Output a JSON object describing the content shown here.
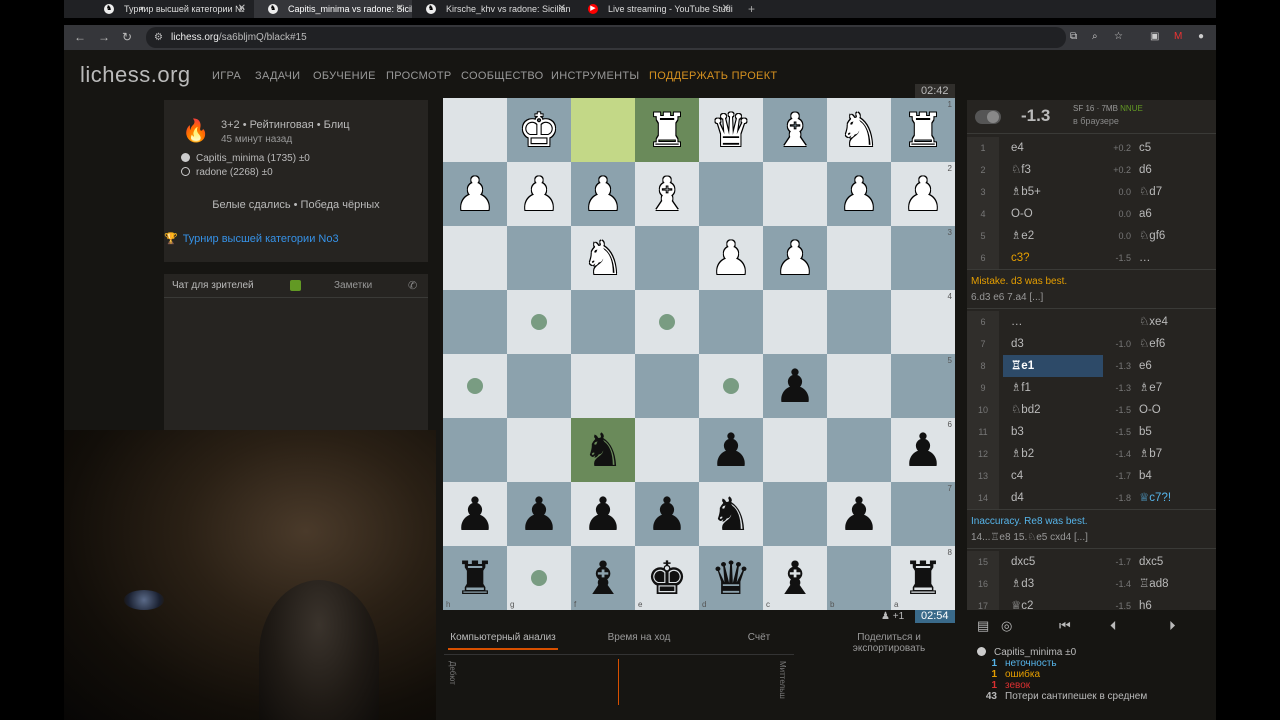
{
  "browser": {
    "tabs": [
      {
        "title": "Турнир высшей категории №",
        "icon": "lichess-icon"
      },
      {
        "title": "Capitis_minima vs radone: Sicili",
        "icon": "lichess-icon"
      },
      {
        "title": "Kirsche_khv vs radone: Sicilian ",
        "icon": "lichess-icon"
      },
      {
        "title": "Live streaming - YouTube Studi",
        "icon": "youtube-icon"
      }
    ],
    "active_tab_index": 1,
    "url_host": "lichess.org",
    "url_path": "/sa6bljmQ/black#15"
  },
  "site": {
    "logo": "lichess.org",
    "nav": [
      "ИГРА",
      "ЗАДАЧИ",
      "ОБУЧЕНИЕ",
      "ПРОСМОТР",
      "СООБЩЕСТВО",
      "ИНСТРУМЕНТЫ"
    ],
    "donate": "ПОДДЕРЖАТЬ ПРОЕКТ"
  },
  "game": {
    "title": "3+2 • Рейтинговая • Блиц",
    "time_ago": "45 минут назад",
    "white_player": "Capitis_minima (1735) ±0",
    "black_player": "radone (2268) ±0",
    "status": "Белые сдались • Победа чёрных",
    "tournament": "Турнир высшей категории No3"
  },
  "chat": {
    "spectator_tab": "Чат для зрителей",
    "notes_tab": "Заметки"
  },
  "clocks": {
    "top": "02:42",
    "bottom": "02:54",
    "bottom_extra": "+1"
  },
  "board": {
    "ranks_labels": [
      "1",
      "2",
      "3",
      "4",
      "5",
      "6",
      "7",
      "8"
    ],
    "files_labels": [
      "h",
      "g",
      "f",
      "e",
      "d",
      "c",
      "b",
      "a"
    ],
    "rows": [
      [
        "",
        "wK",
        "",
        "wR",
        "wQ",
        "wB",
        "wN",
        "wR"
      ],
      [
        "wP",
        "wP",
        "wP",
        "wB",
        "",
        "",
        "wP",
        "wP"
      ],
      [
        "",
        "",
        "wN",
        "",
        "wP",
        "wP",
        "",
        ""
      ],
      [
        "",
        "",
        "",
        "",
        "",
        "",
        "",
        ""
      ],
      [
        "",
        "",
        "",
        "",
        "",
        "bP",
        "",
        ""
      ],
      [
        "",
        "",
        "bN",
        "",
        "bP",
        "",
        "",
        "bP"
      ],
      [
        "bP",
        "bP",
        "bP",
        "bP",
        "bN",
        "",
        "bP",
        ""
      ],
      [
        "bR",
        "",
        "bB",
        "bK",
        "bQ",
        "bB",
        "",
        "bR"
      ]
    ],
    "highlight_squares": [
      [
        0,
        2
      ],
      [
        0,
        3
      ],
      [
        5,
        2
      ]
    ],
    "move_dots": [
      [
        3,
        1
      ],
      [
        3,
        3
      ],
      [
        4,
        0
      ],
      [
        4,
        4
      ],
      [
        7,
        1
      ]
    ]
  },
  "analysis_tabs": [
    "Компьютерный анализ",
    "Время на ход",
    "Счёт",
    "Поделиться и экспортировать"
  ],
  "graph": {
    "label_left": "Дебют",
    "label_right": "Миттельш"
  },
  "engine": {
    "eval": "-1.3",
    "name": "SF 16 · 7MB",
    "nnue": "NNUE",
    "sub": "в браузере"
  },
  "moves_a": [
    {
      "n": "1",
      "w": "e4",
      "we": "+0.2",
      "b": "c5"
    },
    {
      "n": "2",
      "w": "♘f3",
      "we": "+0.2",
      "b": "d6"
    },
    {
      "n": "3",
      "w": "♗b5+",
      "we": "0.0",
      "b": "♘d7"
    },
    {
      "n": "4",
      "w": "O-O",
      "we": "0.0",
      "b": "a6"
    },
    {
      "n": "5",
      "w": "♗e2",
      "we": "0.0",
      "b": "♘gf6"
    },
    {
      "n": "6",
      "w": "c3?",
      "we": "-1.5",
      "b": "…"
    }
  ],
  "comment_a": {
    "text": "Mistake. d3 was best.",
    "line": "6.d3 e6 7.a4 [...]"
  },
  "moves_b": [
    {
      "n": "6",
      "w": "…",
      "we": "",
      "b": "♘xe4"
    },
    {
      "n": "7",
      "w": "d3",
      "we": "-1.0",
      "b": "♘ef6"
    },
    {
      "n": "8",
      "w": "♖e1",
      "we": "-1.3",
      "b": "e6"
    },
    {
      "n": "9",
      "w": "♗f1",
      "we": "-1.3",
      "b": "♗e7"
    },
    {
      "n": "10",
      "w": "♘bd2",
      "we": "-1.5",
      "b": "O-O"
    },
    {
      "n": "11",
      "w": "b3",
      "we": "-1.5",
      "b": "b5"
    },
    {
      "n": "12",
      "w": "♗b2",
      "we": "-1.4",
      "b": "♗b7"
    },
    {
      "n": "13",
      "w": "c4",
      "we": "-1.7",
      "b": "b4"
    },
    {
      "n": "14",
      "w": "d4",
      "we": "-1.8",
      "b": "♕c7?!"
    }
  ],
  "comment_b": {
    "text": "Inaccuracy. Re8 was best.",
    "line": "14...♖e8 15.♘e5 cxd4 [...]"
  },
  "moves_c": [
    {
      "n": "15",
      "w": "dxc5",
      "we": "-1.7",
      "b": "dxc5"
    },
    {
      "n": "16",
      "w": "♗d3",
      "we": "-1.4",
      "b": "♖ad8"
    },
    {
      "n": "17",
      "w": "♕c2",
      "we": "-1.5",
      "b": "h6"
    }
  ],
  "acpl": {
    "player": "Capitis_minima ±0",
    "inacc_count": "1",
    "inacc_label": "неточность",
    "mistake_count": "1",
    "mistake_label": "ошибка",
    "blunder_count": "1",
    "blunder_label": "зевок",
    "avg_count": "43",
    "avg_label": "Потери сантипешек в среднем"
  },
  "colors": {
    "donate": "#d59120",
    "link": "#3692e7",
    "mistake": "#e69f00",
    "inaccuracy": "#56b4e9",
    "blunder": "#db3031",
    "selected": "#2d4a68"
  }
}
